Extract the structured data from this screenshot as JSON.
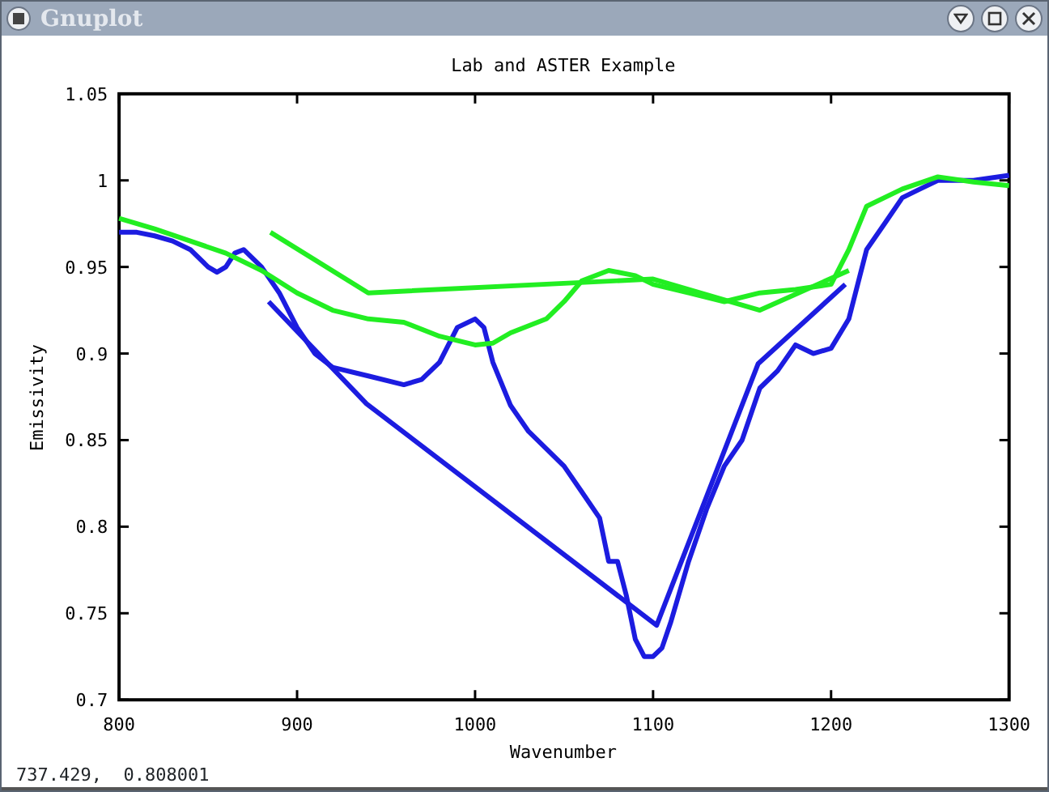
{
  "window": {
    "title": "Gnuplot"
  },
  "plot": {
    "chart_data": {
      "type": "line",
      "title": "Lab and ASTER Example",
      "xlabel": "Wavenumber",
      "ylabel": "Emissivity",
      "xlim": [
        800,
        1300
      ],
      "ylim": [
        0.7,
        1.05
      ],
      "xticks": [
        800,
        900,
        1000,
        1100,
        1200,
        1300
      ],
      "yticks": [
        0.7,
        0.75,
        0.8,
        0.85,
        0.9,
        0.95,
        1,
        1.05
      ],
      "series": [
        {
          "color": "#1c1ce0",
          "x": [
            800,
            810,
            820,
            830,
            840,
            850,
            855,
            860,
            865,
            870,
            880,
            890,
            900,
            910,
            920,
            940,
            960,
            970,
            980,
            990,
            1000,
            1005,
            1010,
            1020,
            1030,
            1040,
            1050,
            1060,
            1070,
            1075,
            1080,
            1085,
            1090,
            1095,
            1100,
            1105,
            1110,
            1120,
            1130,
            1140,
            1150,
            1160,
            1170,
            1180,
            1190,
            1200,
            1210,
            1220,
            1230,
            1240,
            1250,
            1260,
            1280,
            1300
          ],
          "values": [
            0.97,
            0.97,
            0.968,
            0.965,
            0.96,
            0.95,
            0.947,
            0.95,
            0.958,
            0.96,
            0.95,
            0.935,
            0.915,
            0.9,
            0.892,
            0.887,
            0.882,
            0.885,
            0.895,
            0.915,
            0.92,
            0.915,
            0.895,
            0.87,
            0.855,
            0.845,
            0.835,
            0.82,
            0.805,
            0.78,
            0.78,
            0.76,
            0.735,
            0.725,
            0.725,
            0.73,
            0.745,
            0.78,
            0.81,
            0.835,
            0.85,
            0.88,
            0.89,
            0.905,
            0.9,
            0.903,
            0.92,
            0.96,
            0.975,
            0.99,
            0.995,
            1.0,
            1.0,
            1.003
          ]
        },
        {
          "color": "#1c1ce0",
          "x": [
            884,
            939,
            1102,
            1159,
            1208
          ],
          "values": [
            0.93,
            0.871,
            0.743,
            0.894,
            0.94
          ]
        },
        {
          "color": "#22ee22",
          "x": [
            800,
            820,
            840,
            860,
            880,
            900,
            920,
            940,
            960,
            980,
            1000,
            1010,
            1020,
            1040,
            1050,
            1060,
            1075,
            1090,
            1100,
            1120,
            1140,
            1160,
            1180,
            1200,
            1210,
            1220,
            1240,
            1260,
            1280,
            1300
          ],
          "values": [
            0.978,
            0.972,
            0.965,
            0.958,
            0.948,
            0.935,
            0.925,
            0.92,
            0.918,
            0.91,
            0.905,
            0.906,
            0.912,
            0.92,
            0.93,
            0.942,
            0.948,
            0.945,
            0.94,
            0.935,
            0.93,
            0.935,
            0.937,
            0.94,
            0.96,
            0.985,
            0.995,
            1.002,
            0.999,
            0.997
          ]
        },
        {
          "color": "#22ee22",
          "x": [
            885,
            940,
            1100,
            1160,
            1210
          ],
          "values": [
            0.97,
            0.935,
            0.943,
            0.925,
            0.948
          ]
        }
      ]
    }
  },
  "status_bar": {
    "text": "737.429,  0.808001"
  }
}
